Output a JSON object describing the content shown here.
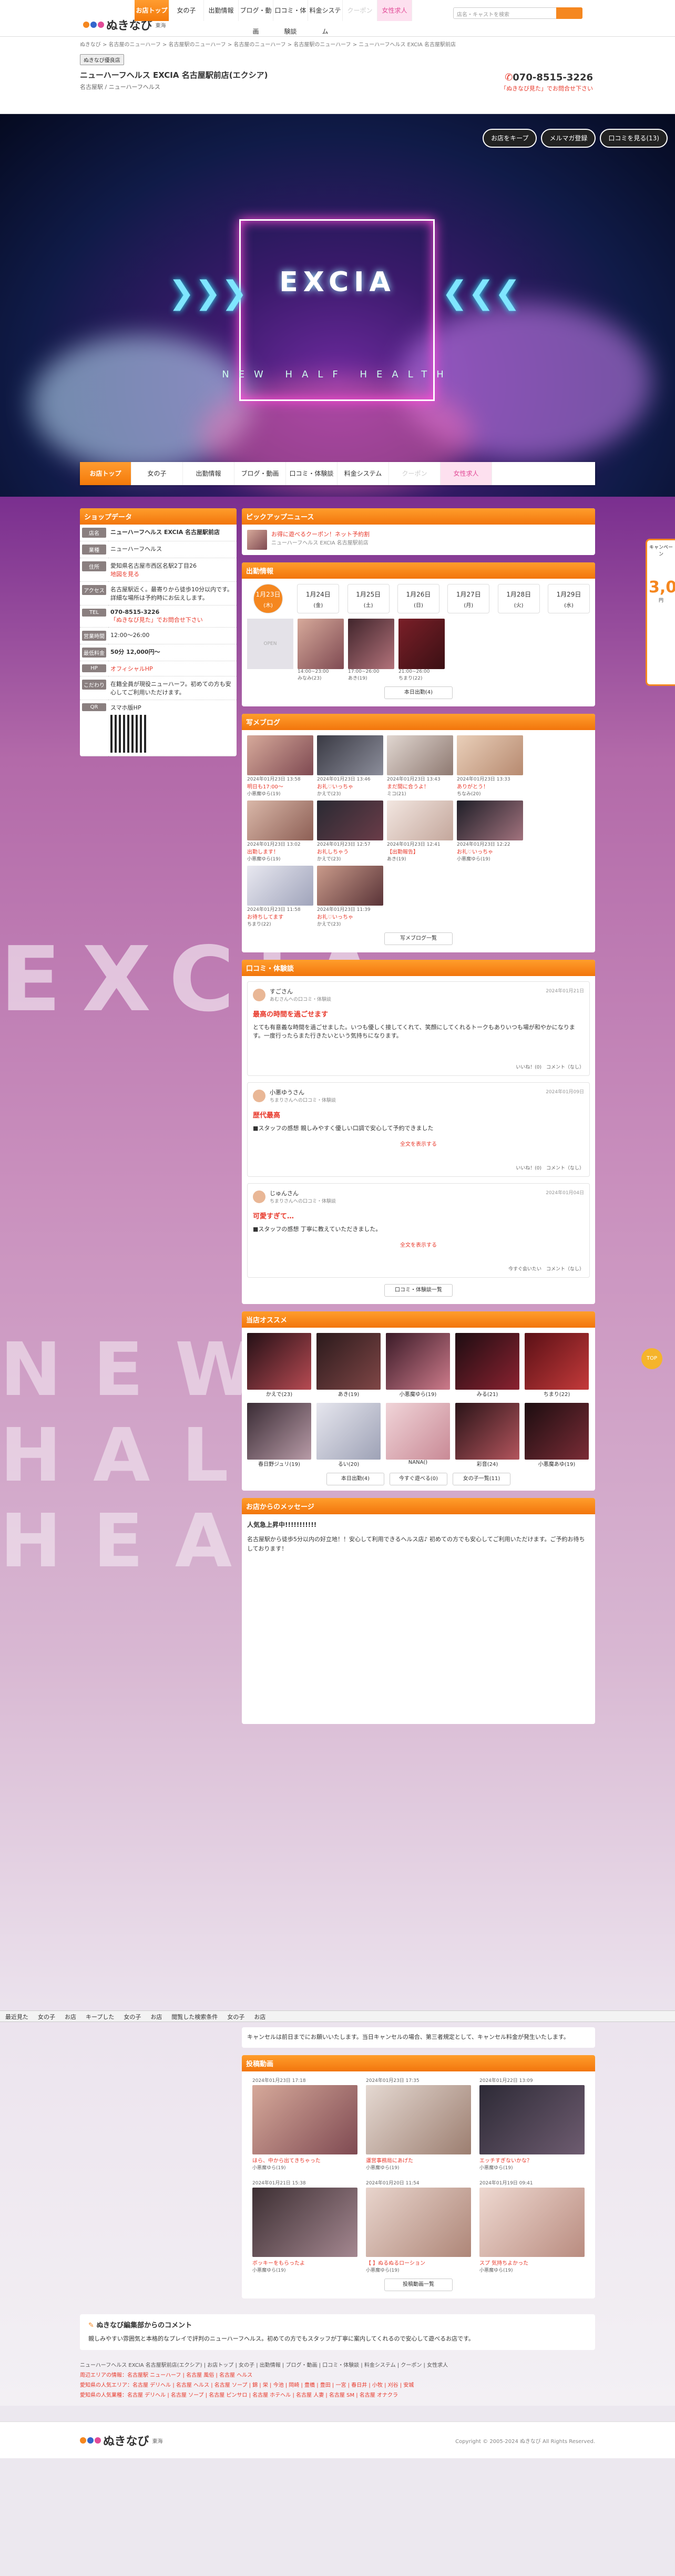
{
  "site": {
    "logo": "ぬきなび",
    "region": "東海",
    "search_placeholder": "店名・キャストを検索"
  },
  "topnav": [
    "お店トップ",
    "女の子",
    "出勤情報",
    "ブログ・動画",
    "口コミ・体験談",
    "料金システム",
    "クーポン",
    "女性求人"
  ],
  "breadcrumb": "ぬきなび > 名古屋のニューハーフ > 名古屋駅のニューハーフ > 名古屋のニューハーフ > 名古屋駅のニューハーフ > ニューハーフヘルス EXCIA 名古屋駅前店",
  "shop": {
    "badge": "ぬきなび優良店",
    "name": "ニューハーフヘルス EXCIA 名古屋駅前店(エクシア)",
    "sub": "名古屋駅 / ニューハーフヘルス",
    "tel": "070-8515-3226",
    "tel_note": "「ぬきなび見た」でお問合せ下さい"
  },
  "hero": {
    "logo": "EXCIA",
    "tagline": "NEW HALF HEALTH",
    "buttons": [
      "お店をキープ",
      "メルマガ登録",
      "口コミを見る(13)"
    ]
  },
  "shopdata": {
    "title": "ショップデータ",
    "rows": [
      {
        "k": "店名",
        "v": "ニューハーフヘルス EXCIA 名古屋駅前店"
      },
      {
        "k": "業種",
        "v": "ニューハーフヘルス"
      },
      {
        "k": "住所",
        "v": "愛知県名古屋市西区名駅2丁目26"
      },
      {
        "k": "アクセス",
        "v": "名古屋駅近く。最寄りから徒歩10分以内です。詳細な場所は予約時にお伝えします。"
      },
      {
        "k": "TEL",
        "v": "070-8515-3226"
      },
      {
        "k": "営業時間",
        "v": "12:00〜26:00"
      },
      {
        "k": "最低料金",
        "v": "50分 12,000円〜"
      },
      {
        "k": "HP",
        "v": "オフィシャルHP"
      },
      {
        "k": "こだわり",
        "v": "在籍全員が現役ニューハーフ。初めての方も安心してご利用いただけます。"
      },
      {
        "k": "QR",
        "v": "スマホ版HP"
      }
    ],
    "map_link": "地図を見る"
  },
  "pickup": {
    "title": "ピックアップニュース",
    "text": "お得に遊べるクーポン！ネット予約割",
    "sub": "ニューハーフヘルス EXCIA 名古屋駅前店"
  },
  "schedule": {
    "title": "出勤情報",
    "days": [
      {
        "d": "1月23日",
        "w": "(木)"
      },
      {
        "d": "1月24日",
        "w": "(金)"
      },
      {
        "d": "1月25日",
        "w": "(土)"
      },
      {
        "d": "1月26日",
        "w": "(日)"
      },
      {
        "d": "1月27日",
        "w": "(月)"
      },
      {
        "d": "1月28日",
        "w": "(火)"
      },
      {
        "d": "1月29日",
        "w": "(水)"
      }
    ],
    "girls": [
      {
        "n": "OPEN",
        "t": ""
      },
      {
        "n": "みなみ(23)",
        "t": "14:00~23:00"
      },
      {
        "n": "あき(19)",
        "t": "17:00~26:00"
      },
      {
        "n": "ちまり(22)",
        "t": "21:00~26:00"
      }
    ],
    "more": "本日出勤(4)"
  },
  "blog": {
    "title": "写メブログ",
    "posts": [
      {
        "d": "2024年01月23日 13:58",
        "t": "明日も17:00〜",
        "n": "小悪魔ゆら(19)"
      },
      {
        "d": "2024年01月23日 13:46",
        "t": "お礼♡いっちゃ",
        "n": "かえで(23)"
      },
      {
        "d": "2024年01月23日 13:43",
        "t": "まだ間に合うよ！",
        "n": "ミコ(21)"
      },
      {
        "d": "2024年01月23日 13:33",
        "t": "ありがとう！",
        "n": "ちなみ(20)"
      },
      {
        "d": "2024年01月23日 13:02",
        "t": "出勤します！",
        "n": "小悪魔ゆら(19)"
      },
      {
        "d": "2024年01月23日 12:57",
        "t": "お礼しちゃう",
        "n": "かえで(23)"
      },
      {
        "d": "2024年01月23日 12:41",
        "t": "【出勤報告】",
        "n": "あき(19)"
      },
      {
        "d": "2024年01月23日 12:22",
        "t": "お礼♡いっちゃ",
        "n": "小悪魔ゆら(19)"
      },
      {
        "d": "2024年01月23日 11:58",
        "t": "お待ちしてます",
        "n": "ちまり(22)"
      },
      {
        "d": "2024年01月23日 11:39",
        "t": "お礼♡いっちゃ",
        "n": "かえで(23)"
      }
    ],
    "more": "写メブログ一覧"
  },
  "reviews": {
    "title": "口コミ・体験談",
    "items": [
      {
        "who": "すごさん",
        "to": "あむさんへの口コミ・体験談",
        "date": "2024年01月21日",
        "h": "最高の時間を過ごせます",
        "body": "とても有意義な時間を過ごせました。いつも優しく接してくれて、笑顔にしてくれるトークもありいつも場が和やかになります。一度行ったらまた行きたいという気持ちになります。",
        "like": "いいね！(0)",
        "com": "コメント（なし）"
      },
      {
        "who": "小悪ゆうさん",
        "to": "ちまりさんへの口コミ・体験談",
        "date": "2024年01月09日",
        "h": "歴代最高",
        "body": "■スタッフの感想 親しみやすく優しい口調で安心して予約できました",
        "like": "いいね！(0)",
        "com": "コメント（なし）"
      },
      {
        "who": "じゅんさん",
        "to": "ちまりさんへの口コミ・体験談",
        "date": "2024年01月04日",
        "h": "可愛すぎて…",
        "body": "■スタッフの感想 丁寧に教えていただきました。",
        "like": "今すぐ会いたい",
        "com": "コメント（なし）"
      }
    ],
    "more_btn": "全文を表示する",
    "list": "口コミ・体験談一覧"
  },
  "recommend": {
    "title": "当店オススメ",
    "girls": [
      "かえで(23)",
      "あき(19)",
      "小悪魔ゆら(19)",
      "みる(21)",
      "ちまり(22)",
      "春日野ジュリ(19)",
      "るい(20)",
      "NANA()",
      "彩音(24)",
      "小悪魔あゆ(19)"
    ],
    "btns": [
      "本日出勤(4)",
      "今すぐ遊べる(0)",
      "女の子一覧(11)"
    ]
  },
  "message": {
    "title": "お店からのメッセージ",
    "head": "人気急上昇中!!!!!!!!!!!",
    "body": "名古屋駅から徒歩5分以内の好立地！！安心して利用できるヘルス店♪ 初めての方でも安心してご利用いただけます。ご予約お待ちしております！",
    "note": "キャンセルは前日までにお願いいたします。当日キャンセルの場合、第三者規定として、キャンセル料金が発生いたします。"
  },
  "gallery": {
    "title": "投稿動画",
    "items": [
      {
        "d": "2024年01月23日 17:18",
        "t": "ほら、中から出てきちゃった",
        "n": "小悪魔ゆら(19)"
      },
      {
        "d": "2024年01月23日 17:35",
        "t": "運営事務局にあげた",
        "n": "小悪魔ゆら(19)"
      },
      {
        "d": "2024年01月22日 13:09",
        "t": "エッチすぎないかな？",
        "n": "小悪魔ゆら(19)"
      },
      {
        "d": "2024年01月21日 15:38",
        "t": "ボッキーをもらったよ",
        "n": "小悪魔ゆら(19)"
      },
      {
        "d": "2024年01月20日 11:54",
        "t": "【 】ぬるぬるローション",
        "n": "小悪魔ゆら(19)"
      },
      {
        "d": "2024年01月19日 09:41",
        "t": "スプ 気持ちよかった",
        "n": "小悪魔ゆら(19)"
      }
    ],
    "more": "投稿動画一覧"
  },
  "sticky": [
    "最近見た",
    "女の子",
    "お店",
    "キープした",
    "女の子",
    "お店",
    "閲覧した検索条件",
    "女の子",
    "お店"
  ],
  "banner": {
    "top": "キャンペーン",
    "big": "3,000",
    "unit": "円"
  },
  "editor": {
    "title": "ぬきなび編集部からのコメント",
    "body": "親しみやすい雰囲気と本格的なプレイで評判のニューハーフヘルス。初めての方でもスタッフが丁寧に案内してくれるので安心して遊べるお店です。",
    "gotop": "TOP"
  },
  "footer_links": [
    "ニューハーフヘルス EXCIA 名古屋駅前店(エクシア) | お店トップ | 女の子 | 出勤情報 | ブログ・動画 | 口コミ・体験談 | 料金システム | クーポン | 女性求人",
    "周辺エリアの情報：名古屋駅 ニューハーフ | 名古屋 風俗 | 名古屋 ヘルス",
    "愛知県の人気エリア：名古屋 デリヘル | 名古屋 ヘルス | 名古屋 ソープ | 錦 | 栄 | 今池 | 岡崎 | 豊橋 | 豊田 | 一宮 | 春日井 | 小牧 | 刈谷 | 安城",
    "愛知県の人気業種：名古屋 デリヘル | 名古屋 ソープ | 名古屋 ピンサロ | 名古屋 ホテヘル | 名古屋 人妻 | 名古屋 SM | 名古屋 オナクラ"
  ],
  "copyright": "Copyright © 2005-2024 ぬきなび All Rights Reserved."
}
